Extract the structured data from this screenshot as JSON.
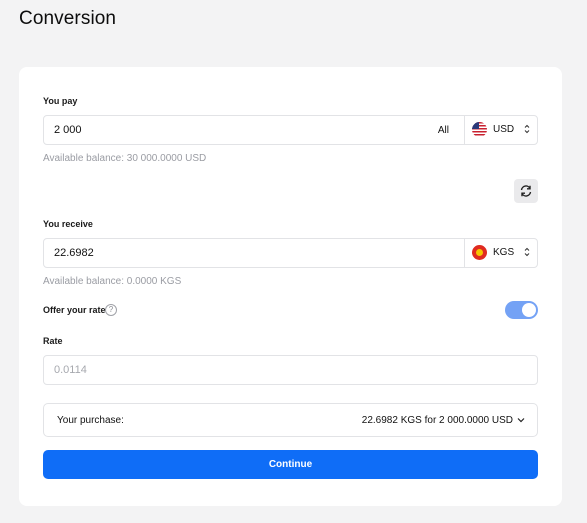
{
  "page": {
    "title": "Conversion"
  },
  "pay": {
    "label": "You pay",
    "value": "2 000",
    "all_label": "All",
    "currency": "USD",
    "currency_flag_icon": "us-flag-icon",
    "balance": "Available balance: 30 000.0000 USD"
  },
  "swap": {
    "icon": "refresh-icon"
  },
  "receive": {
    "label": "You receive",
    "value": "22.6982",
    "currency": "KGS",
    "currency_flag_icon": "kg-flag-icon",
    "balance": "Available balance: 0.0000 KGS"
  },
  "offer_rate": {
    "label": "Offer your rate",
    "help_icon": "?",
    "enabled": true
  },
  "rate": {
    "label": "Rate",
    "placeholder": "0.0114"
  },
  "purchase": {
    "label": "Your purchase:",
    "summary": "22.6982 KGS for 2 000.0000 USD"
  },
  "continue_label": "Continue",
  "colors": {
    "background": "#f3f3f4",
    "accent": "#0f6df7",
    "toggle_on": "#74a2f5",
    "muted_text": "#9a9ca3"
  }
}
